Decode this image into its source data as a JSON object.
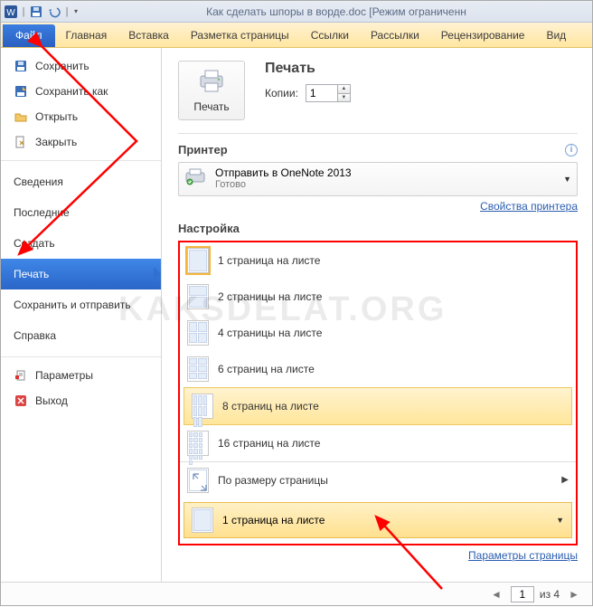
{
  "titlebar": {
    "title": "Как сделать шпоры в ворде.doc [Режим ограниченн"
  },
  "ribbon": {
    "file": "Файл",
    "tabs": [
      "Главная",
      "Вставка",
      "Разметка страницы",
      "Ссылки",
      "Рассылки",
      "Рецензирование",
      "Вид"
    ]
  },
  "sidebar": {
    "save": "Сохранить",
    "save_as": "Сохранить как",
    "open": "Открыть",
    "close": "Закрыть",
    "info": "Сведения",
    "recent": "Последние",
    "new": "Создать",
    "print": "Печать",
    "share": "Сохранить и отправить",
    "help": "Справка",
    "options": "Параметры",
    "exit": "Выход"
  },
  "main": {
    "print_heading": "Печать",
    "print_button": "Печать",
    "copies_label": "Копии:",
    "copies_value": "1",
    "printer_label": "Принтер",
    "printer_name": "Отправить в OneNote 2013",
    "printer_status": "Готово",
    "printer_props": "Свойства принтера",
    "settings_label": "Настройка",
    "pages_per_sheet": {
      "opt1": "1 страница на листе",
      "opt2": "2 страницы на листе",
      "opt4": "4 страницы на листе",
      "opt6": "6 страниц на листе",
      "opt8": "8 страниц на листе",
      "opt16": "16 страниц на листе",
      "scale": "По размеру страницы",
      "selected": "1 страница на листе"
    },
    "page_setup": "Параметры страницы"
  },
  "pager": {
    "page_value": "1",
    "of_label": "из 4"
  },
  "watermark": "KAKSDELAT.ORG"
}
